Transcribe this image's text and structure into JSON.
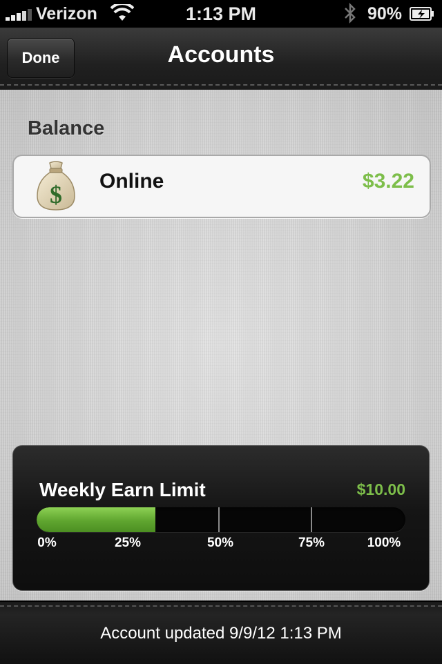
{
  "status_bar": {
    "carrier": "Verizon",
    "time": "1:13 PM",
    "battery_percent": "90%"
  },
  "nav": {
    "title": "Accounts",
    "done_label": "Done"
  },
  "balance": {
    "section_title": "Balance",
    "accounts": [
      {
        "name": "Online",
        "amount": "$3.22",
        "icon": "money-bag-icon"
      }
    ]
  },
  "weekly_limit": {
    "label": "Weekly Earn Limit",
    "amount": "$10.00",
    "progress_fraction": 0.322,
    "tick_labels": [
      "0%",
      "25%",
      "50%",
      "75%",
      "100%"
    ]
  },
  "footer": {
    "updated_text": "Account updated 9/9/12 1:13 PM"
  },
  "colors": {
    "accent_green": "#7dbe4a",
    "bar_dark": "#1a1a1a"
  }
}
